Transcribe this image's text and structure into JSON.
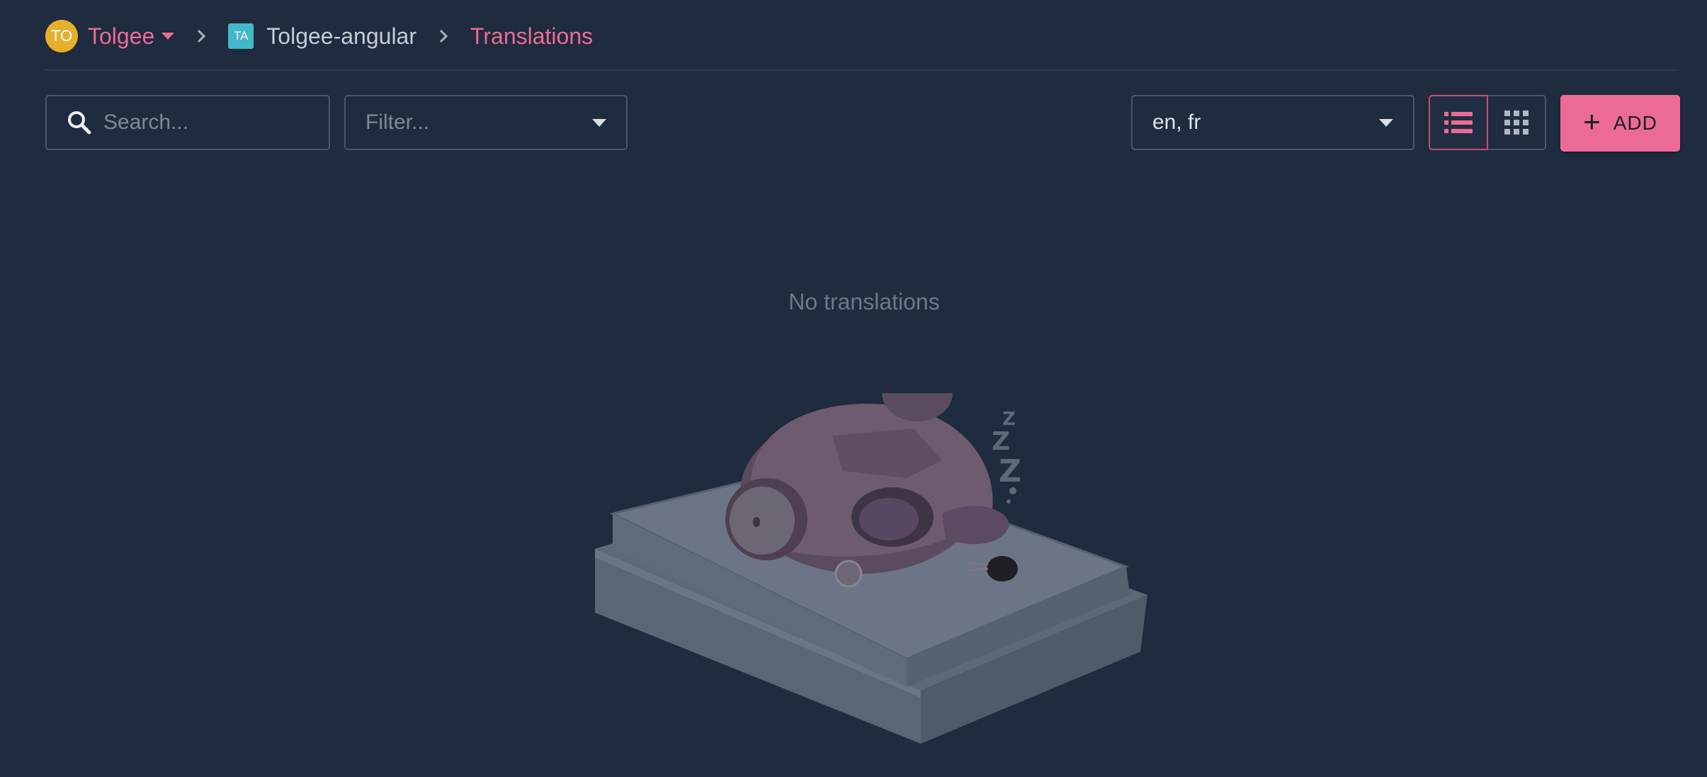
{
  "breadcrumb": {
    "org_avatar": "TO",
    "org_name": "Tolgee",
    "project_avatar": "TA",
    "project_name": "Tolgee-angular",
    "current": "Translations"
  },
  "toolbar": {
    "search_placeholder": "Search...",
    "filter_placeholder": "Filter...",
    "languages_value": "en, fr",
    "add_label": "ADD"
  },
  "empty_state": {
    "message": "No translations",
    "illustration": "sleeping-robot-mouse"
  },
  "icons": {
    "search": "search-icon",
    "list_view": "list-view-icon",
    "grid_view": "grid-view-icon",
    "add": "plus-icon"
  },
  "colors": {
    "background": "#1f2b3e",
    "accent": "#ec6b96",
    "org_avatar": "#e7b02c",
    "project_avatar": "#43b8c9"
  }
}
